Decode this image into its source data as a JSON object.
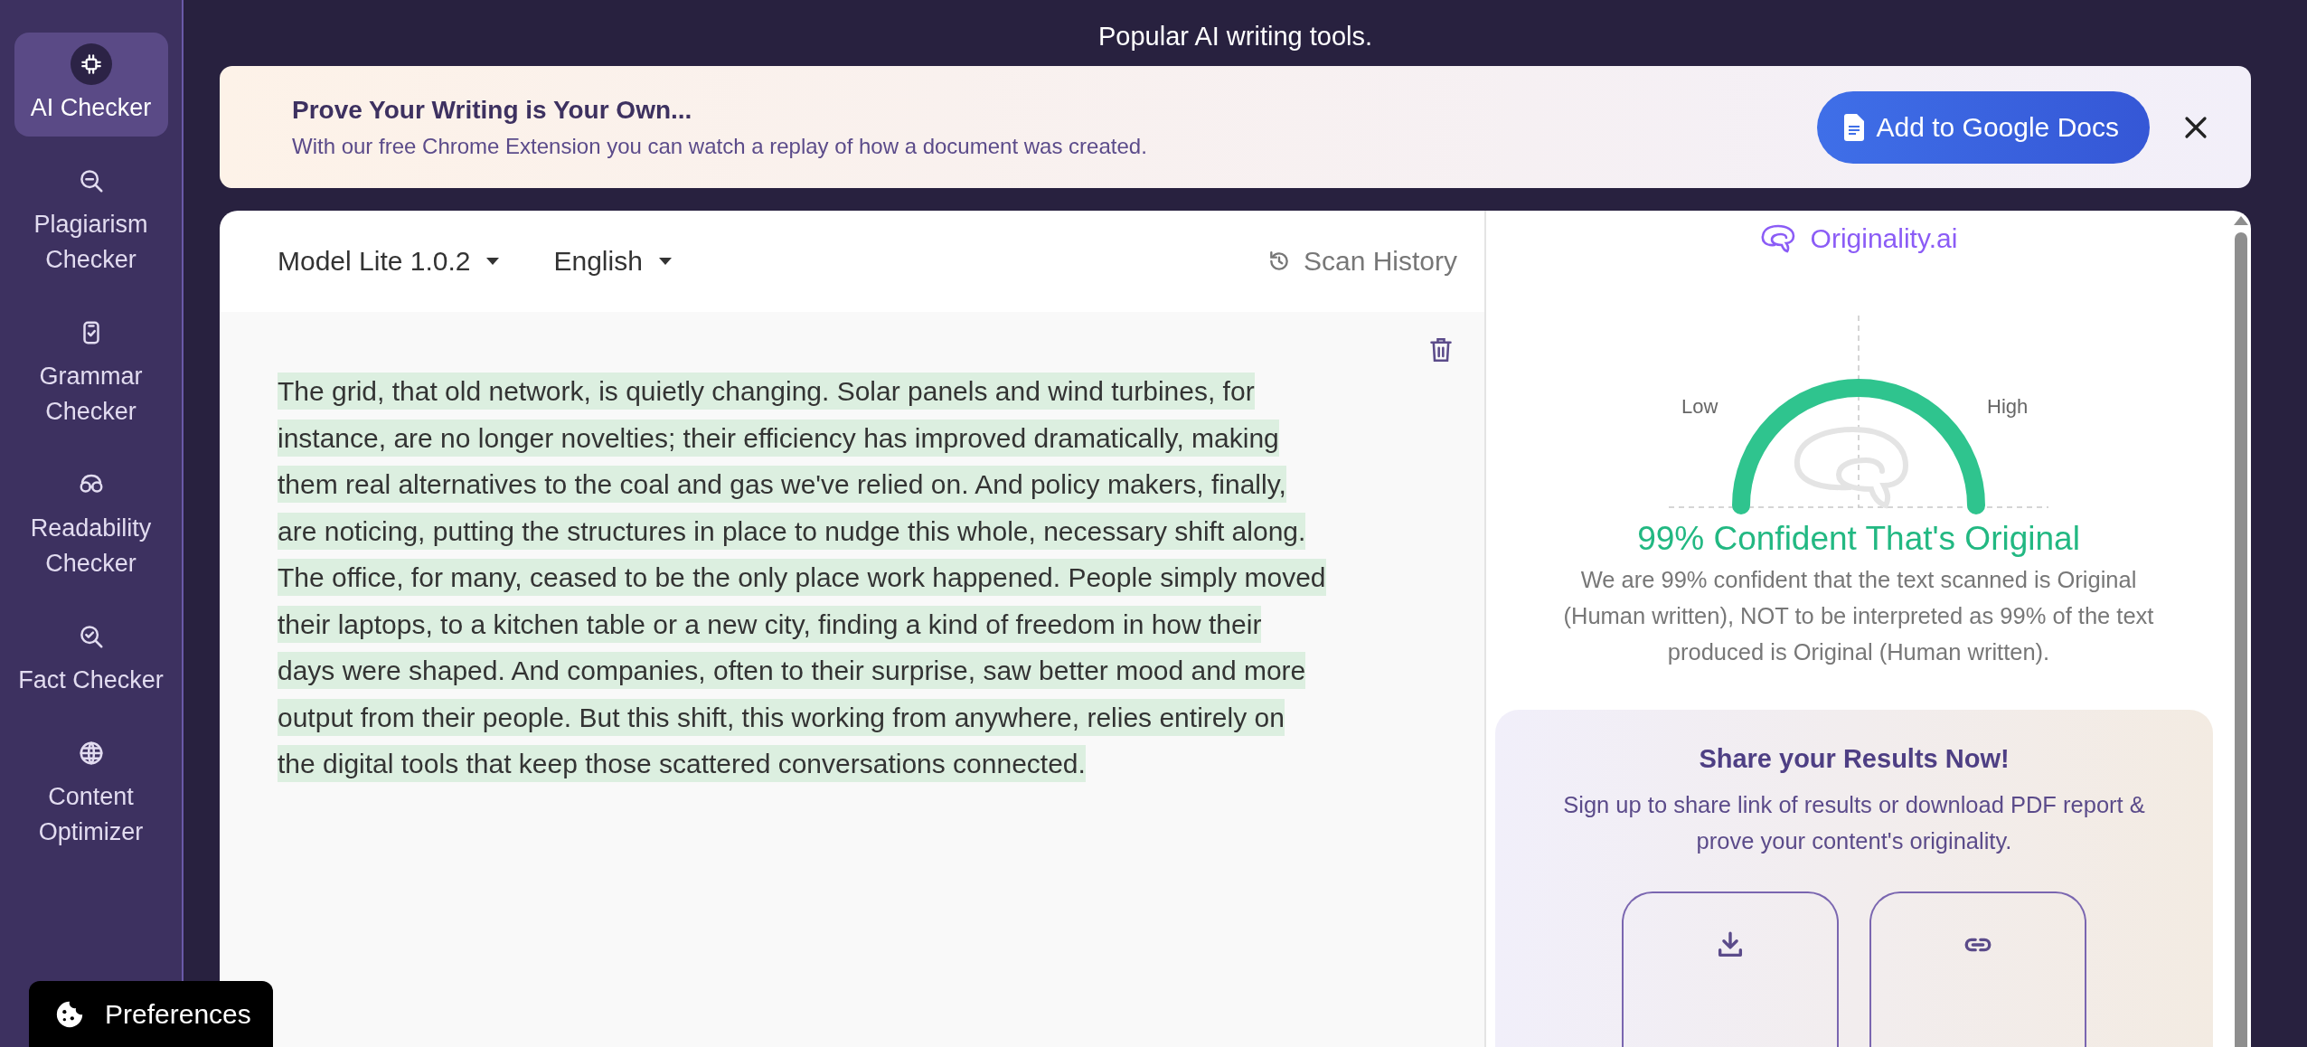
{
  "sidebar": {
    "items": [
      {
        "label": "AI Checker",
        "selected": true
      },
      {
        "label": "Plagiarism Checker",
        "selected": false
      },
      {
        "label": "Grammar Checker",
        "selected": false
      },
      {
        "label": "Readability Checker",
        "selected": false
      },
      {
        "label": "Fact Checker",
        "selected": false
      },
      {
        "label": "Content Optimizer",
        "selected": false
      }
    ]
  },
  "page_title": "Popular AI writing tools.",
  "banner": {
    "title": "Prove Your Writing is Your Own...",
    "subtitle": "With our free Chrome Extension you can watch a replay of how a document was created.",
    "button": "Add to Google Docs"
  },
  "editor": {
    "model": "Model Lite 1.0.2",
    "language": "English",
    "scan_history": "Scan History",
    "segments": [
      {
        "kind": "original",
        "text": "The grid, that old network, is quietly changing. Solar panels and wind turbines, for instance, are no longer novelties; their efficiency has improved dramatically, making them real alternatives to the coal and gas we've relied on. And policy makers, finally, are noticing, putting the structures in place to nudge this whole, necessary shift along. The office, for many, ceased to be the only place work happened. People simply moved their laptops, to a kitchen table or a new city, finding a kind of freedom in how their days were shaped. And companies, often to their surprise, saw better mood and more output from their people. But this shift, this working from anywhere, relies entirely on the digital tools that keep those scattered conversations connected."
      }
    ]
  },
  "results": {
    "brand": "Originality.ai",
    "gauge": {
      "low": "Low",
      "high": "High"
    },
    "verdict": "99% Confident That's Original",
    "explanation": "We are 99% confident that the text scanned is Original (Human written), NOT to be interpreted as 99% of the text produced is Original (Human written).",
    "share": {
      "title": "Share your Results Now!",
      "text": "Sign up to share link of results or download PDF report & prove your content's originality."
    }
  },
  "preferences": "Preferences"
}
